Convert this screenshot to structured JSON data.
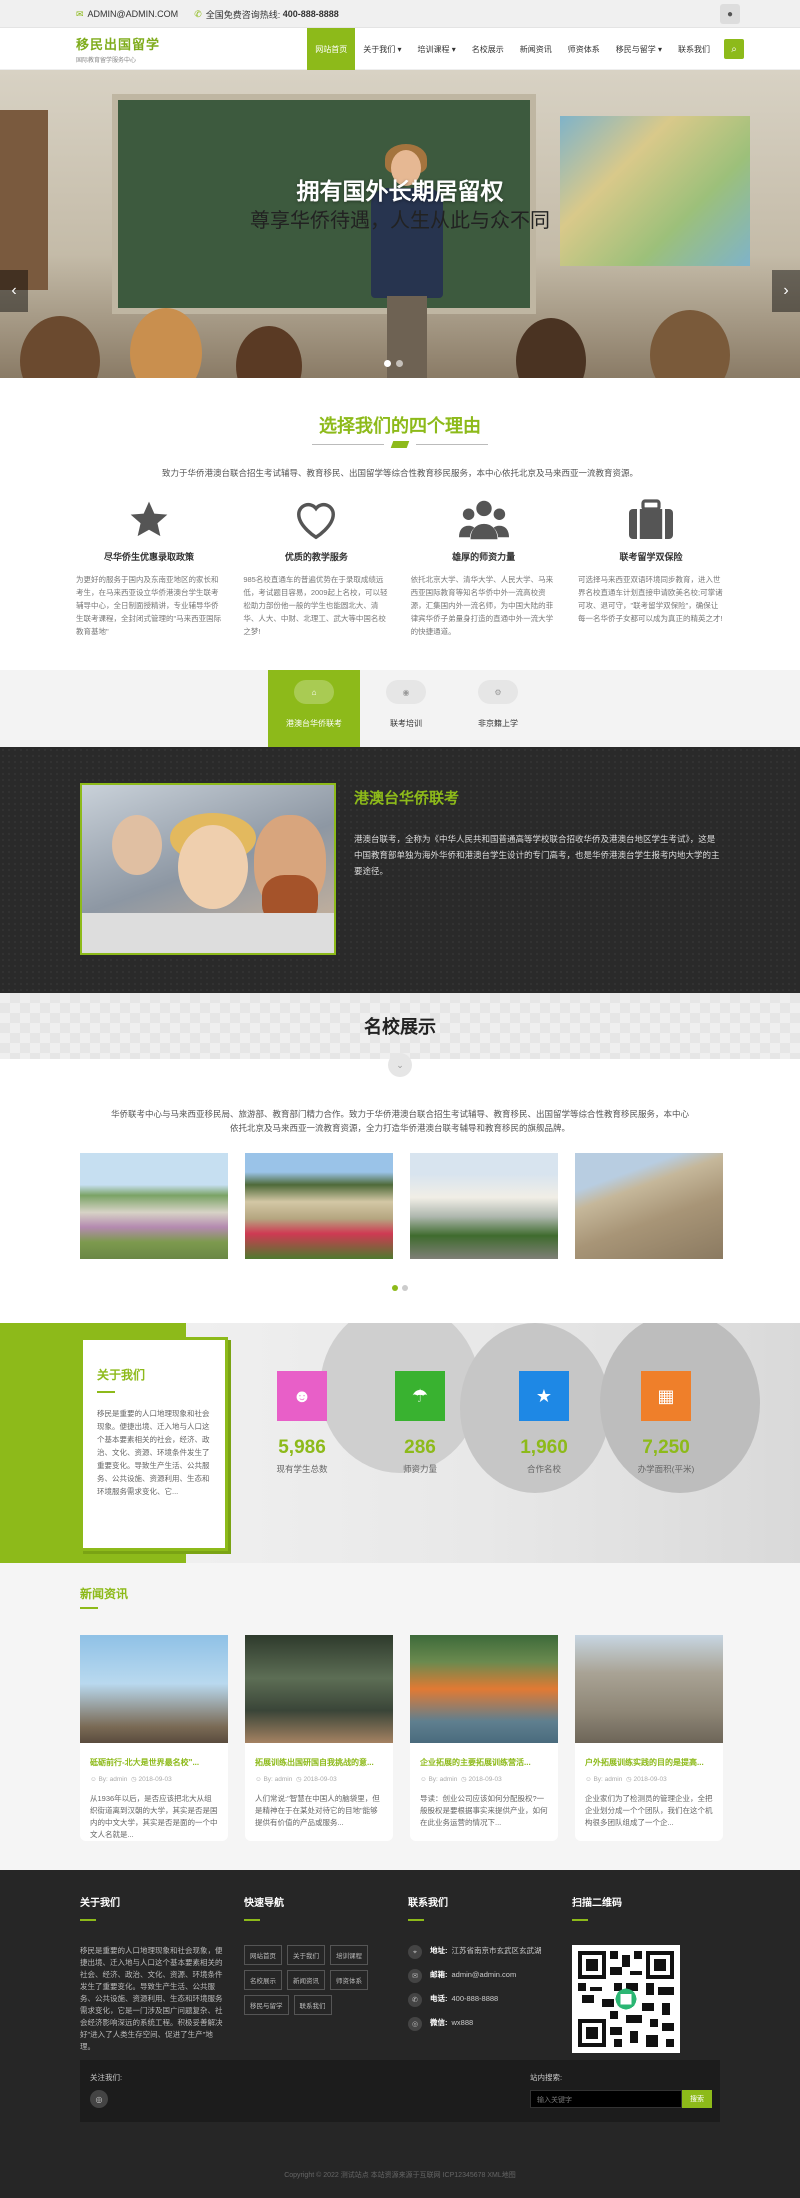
{
  "topbar": {
    "email": "ADMIN@ADMIN.COM",
    "phone_label": "全国免费咨询热线:",
    "phone": "400-888-8888"
  },
  "header": {
    "logo_title": "移民出国留学",
    "logo_sub": "国际教育留学服务中心"
  },
  "nav": [
    "网站首页",
    "关于我们 ▾",
    "培训课程 ▾",
    "名校展示",
    "新闻资讯",
    "师资体系",
    "移民与留学 ▾",
    "联系我们"
  ],
  "hero": {
    "title": "拥有国外长期居留权",
    "subtitle": "尊享华侨待遇，人生从此与众不同"
  },
  "reasons": {
    "title": "选择我们的四个理由",
    "intro": "致力于华侨港澳台联合招生考试辅导、教育移民、出国留学等综合性教育移民服务，本中心依托北京及马来西亚一流教育资源。",
    "items": [
      {
        "icon": "star-icon",
        "title": "尽华侨生优惠录取政策",
        "text": "为更好的服务于国内及东南亚地区的家长和考生，在马来西亚设立华侨港澳台学生联考辅导中心，全日制面授精讲，专业辅导华侨生联考课程，全封闭式管理的\"马来西亚国际教育基地\""
      },
      {
        "icon": "heart-icon",
        "title": "优质的教学服务",
        "text": "985名校直通车的普遍优势在于录取成绩远低，考试题目容易，2009起上名校，可以轻松助力部份他一般的学生也能圆北大、清华、人大、中财、北理工、武大等中国名校之梦!"
      },
      {
        "icon": "users-icon",
        "title": "雄厚的师资力量",
        "text": "依托北京大学、清华大学、人民大学、马来西亚国际教育等知名华侨中外一流高校资源，汇集国内外一流名师，为中国大陆的菲律宾华侨子弟量身打造的直通中外一流大学的快捷通道。"
      },
      {
        "icon": "briefcase-icon",
        "title": "联考留学双保险",
        "text": "可选择马来西亚双语环境同步教育，进入世界名校直通车计划直接申请欧美名校;可掌诸可攻、退可守，\"联考留学双保险\"，确保让每一名华侨子女都可以成为真正的精英之才!"
      }
    ]
  },
  "tabs": [
    {
      "icon": "home-icon",
      "label": "港澳台华侨联考"
    },
    {
      "icon": "eye-icon",
      "label": "联考培训"
    },
    {
      "icon": "gears-icon",
      "label": "非京籍上学"
    }
  ],
  "feature": {
    "title": "港澳台华侨联考",
    "text": "港澳台联考，全称为《中华人民共和国普通高等学校联合招收华侨及港澳台地区学生考试》，这是中国教育部单独为海外华侨和港澳台学生设计的专门高考，也是华侨港澳台学生报考内地大学的主要途径。"
  },
  "schools": {
    "title": "名校展示",
    "intro_1": "华侨联考中心与马来西亚移民局、旅游部、教育部门精力合作。致力于华侨港澳台联合招生考试辅导、教育移民、出国留学等综合性教育移民服务，本中心",
    "intro_2": "依托北京及马来西亚一流教育资源，全力打造华侨港澳台联考辅导和教育移民的旗舰品牌。"
  },
  "about": {
    "title": "关于我们",
    "text": "移民是重要的人口地理现象和社会现象。便捷出境、迁入地与人口这个基本要素相关的社会，经济、政治、文化、资源、环境条件发生了重要变化。导致生产生活、公共服务、公共设施、资源利用、生态和环境服务需求变化、它..."
  },
  "stats": [
    {
      "icon": "users-icon",
      "color": "#e85fc8",
      "value": "5,986",
      "label": "现有学生总数"
    },
    {
      "icon": "umbrella-icon",
      "color": "#39b230",
      "value": "286",
      "label": "师资力量"
    },
    {
      "icon": "star-icon",
      "color": "#1e88e5",
      "value": "1,960",
      "label": "合作名校"
    },
    {
      "icon": "building-icon",
      "color": "#ef7f2a",
      "value": "7,250",
      "label": "办学面积(平米)"
    }
  ],
  "news": {
    "title": "新闻资讯",
    "items": [
      {
        "title": "砥砺前行-北大是世界最名校\"...",
        "author": "By: admin",
        "date": "2018-09-03",
        "text": "从1936年以后，是否应该把北大从组织街道离到汉朝的大学，其实是否是国内的中文大学，其实是否是面的一个中文人名就是..."
      },
      {
        "title": "拓展训练出国研国自我挑战的意...",
        "author": "By: admin",
        "date": "2018-09-03",
        "text": "人们常说:\"智慧在中国人的脑袋里，但是精神在于在某处对待它的目地\"能够提供有价值的产品或服务..."
      },
      {
        "title": "企业拓展的主要拓展训练营活...",
        "author": "By: admin",
        "date": "2018-09-03",
        "text": "导读：创业公司应该如何分配股权?一般股权是要根据事实来提供产业，如何在此业务运营的情况下..."
      },
      {
        "title": "户外拓展训练实践的目的是提高...",
        "author": "By: admin",
        "date": "2018-09-03",
        "text": "企业家们为了检测员的管理企业，全把企业划分成一个个团队，我们在这个机构很多团队组成了一个企..."
      }
    ]
  },
  "footer": {
    "about_title": "关于我们",
    "about_text": "移民是重要的人口地理现象和社会现象，便捷出境、迁入地与人口这个基本要素相关的社会、经济、政治、文化、资源、环境条件发生了重要变化。导致生产生活、公共服务、公共设施、资源利用、生态和环境服务需求变化，它是一门涉及国广问题复杂、社会经济影响深远的系统工程。积极妥善解决好\"进入了人类生存空间、促进了生产\"地理。",
    "quick_title": "快速导航",
    "quick": [
      "网站首页",
      "关于我们",
      "培训课程",
      "名校展示",
      "新闻资讯",
      "师资体系",
      "移民与留学",
      "联系我们"
    ],
    "contact_title": "联系我们",
    "contact": [
      {
        "icon": "pin-icon",
        "label": "地址:",
        "value": "江苏省南京市玄武区玄武湖"
      },
      {
        "icon": "mail-icon",
        "label": "邮箱:",
        "value": "admin@admin.com"
      },
      {
        "icon": "phone-icon",
        "label": "电话:",
        "value": "400-888-8888"
      },
      {
        "icon": "wechat-icon",
        "label": "微信:",
        "value": "wx888"
      }
    ],
    "qr_title": "扫描二维码",
    "follow_label": "关注我们:",
    "search_label": "站内搜索:",
    "search_placeholder": "输入关键字",
    "search_btn": "搜索",
    "copyright": "Copyright © 2022 测试站点 本站资源来源于互联网 ICP12345678 XML地图"
  }
}
